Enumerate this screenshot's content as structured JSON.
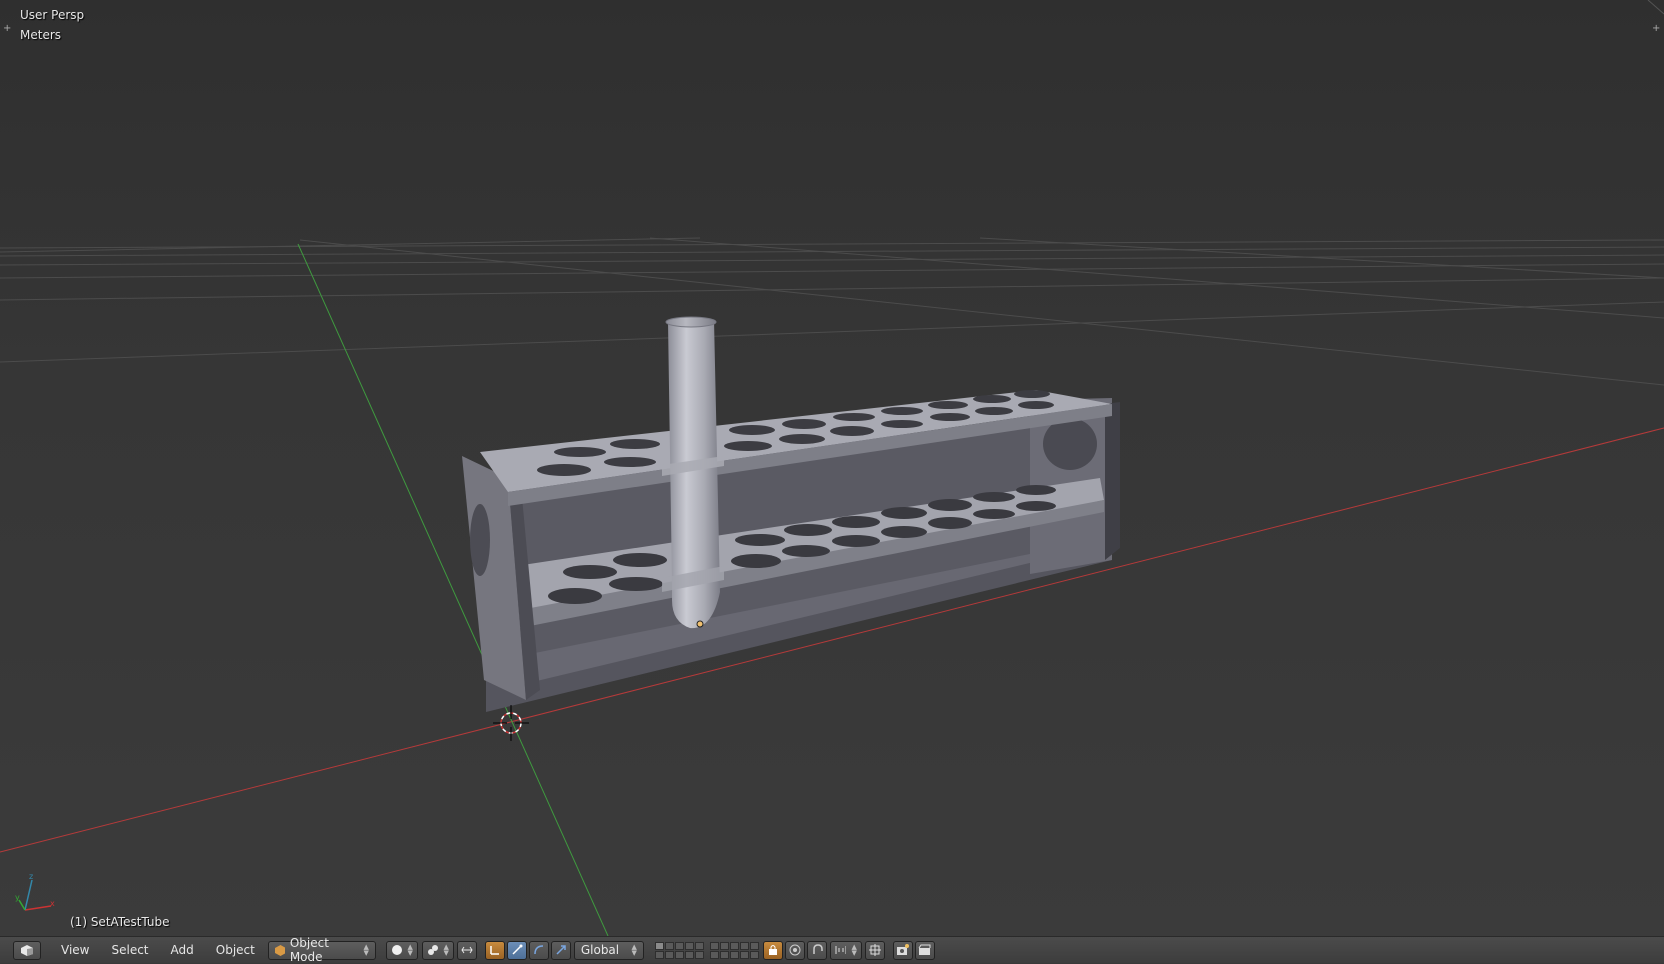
{
  "viewport": {
    "view_name": "User Persp",
    "units": "Meters",
    "active_object": "(1) SetATestTube"
  },
  "header": {
    "menus": [
      "View",
      "Select",
      "Add",
      "Object"
    ],
    "mode": "Object Mode",
    "orientation": "Global"
  },
  "colors": {
    "x_axis": "#b53a3a",
    "y_axis": "#3f9a3f",
    "mesh": "#9a9ba5",
    "accent": "#c88b3e"
  }
}
